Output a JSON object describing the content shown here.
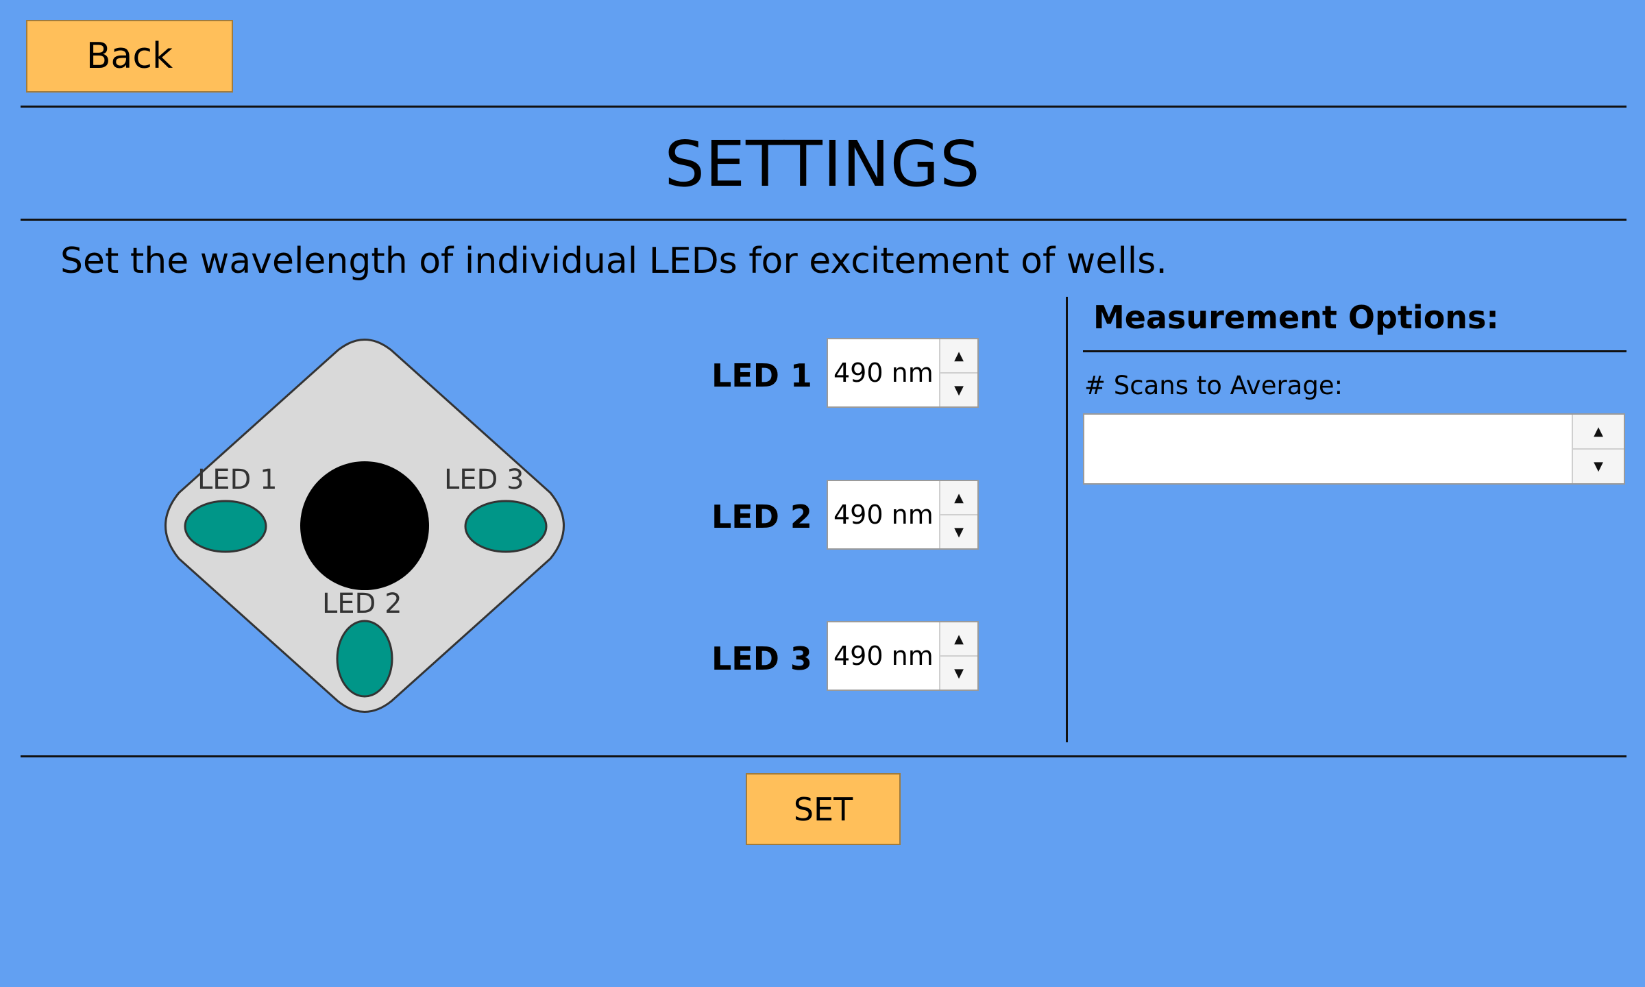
{
  "header": {
    "back_label": "Back",
    "title": "SETTINGS"
  },
  "instructions": "Set the wavelength of individual LEDs for excitement of wells.",
  "diagram": {
    "led1_label": "LED 1",
    "led2_label": "LED 2",
    "led3_label": "LED 3",
    "led_color": "#009688",
    "well_color": "#000000",
    "body_color": "#d9d9d9"
  },
  "leds": [
    {
      "label": "LED 1",
      "value": "490 nm"
    },
    {
      "label": "LED 2",
      "value": "490 nm"
    },
    {
      "label": "LED 3",
      "value": "490 nm"
    }
  ],
  "measurement": {
    "heading": "Measurement Options:",
    "scans_label": "# Scans to Average:",
    "scans_value": ""
  },
  "footer": {
    "set_label": "SET"
  },
  "colors": {
    "background": "#62a0f2",
    "button": "#ffbf5a"
  },
  "icons": {
    "spin_up": "▲",
    "spin_down": "▼"
  }
}
